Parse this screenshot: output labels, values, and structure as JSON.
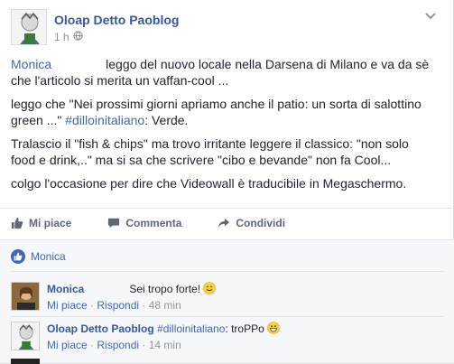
{
  "post": {
    "author": "Oloap Detto Paoblog",
    "time": "1 h",
    "paragraphs": {
      "p1_name": "Monica",
      "p1_text": "leggo del nuovo locale nella Darsena di Milano e va da sè che l'articolo si merita un vaffan-cool ...",
      "p2_a": "leggo che \"Nei prossimi giorni apriamo anche il patio: un sorta di salottino green ...\"",
      "p2_hashtag": "#dilloinitaliano",
      "p2_b": ": Verde.",
      "p3": "Tralascio il \"fish & chips\" ma trovo irritante leggere il classico: \"non solo food e drink,..\" ma si sa che scrivere \"cibo e bevande\" non fa Cool...",
      "p4": "colgo l'occasione per dire che Videowall è traducibile in Megaschermo."
    }
  },
  "actions": {
    "like": "Mi piace",
    "comment": "Commenta",
    "share": "Condividi"
  },
  "likes": {
    "name": "Monica"
  },
  "comments": [
    {
      "author": "Monica",
      "text": "Sei tropo forte!",
      "like": "Mi piace",
      "reply": "Rispondi",
      "time": "48 min"
    },
    {
      "author": "Oloap Detto Paoblog",
      "hashtag": "#dilloinitaliano",
      "text": ": troPPo",
      "like": "Mi piace",
      "reply": "Rispondi",
      "time": "14 min"
    }
  ],
  "colors": {
    "link": "#4267b2",
    "author": "#365899",
    "muted": "#90949c"
  }
}
